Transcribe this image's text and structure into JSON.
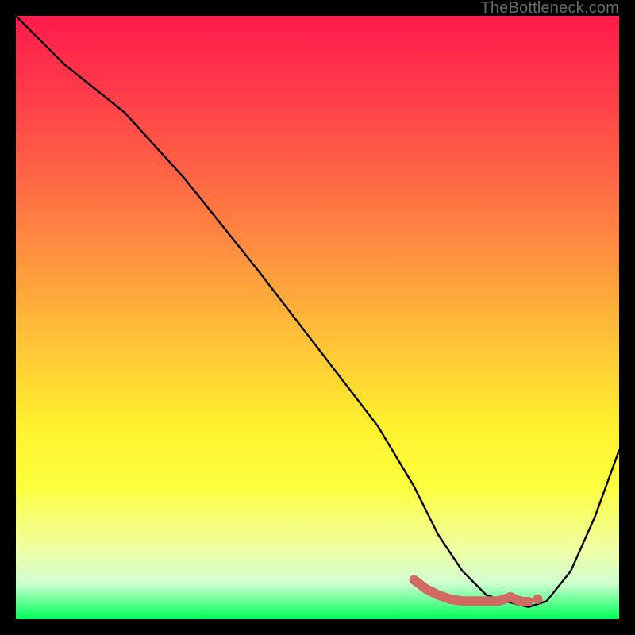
{
  "watermark": {
    "text": "TheBottleneck.com"
  },
  "chart_data": {
    "type": "line",
    "title": "",
    "xlabel": "",
    "ylabel": "",
    "xlim": [
      0,
      100
    ],
    "ylim": [
      0,
      100
    ],
    "grid": false,
    "series": [
      {
        "name": "curve",
        "x": [
          0,
          8,
          18,
          28,
          40,
          50,
          60,
          66,
          70,
          74,
          78,
          81,
          85,
          88,
          92,
          96,
          100
        ],
        "values": [
          100,
          92,
          84,
          73,
          58,
          45,
          32,
          22,
          14,
          8,
          4,
          3,
          2,
          3,
          8,
          17,
          28
        ]
      }
    ],
    "highlight_segment": {
      "color": "#d06a63",
      "x": [
        66,
        68,
        70,
        72,
        74,
        76,
        78,
        80,
        81,
        82,
        83,
        84,
        85
      ],
      "values": [
        6.5,
        5,
        4,
        3.3,
        3,
        3,
        3,
        3,
        3.3,
        3.7,
        3.2,
        2.9,
        2.9
      ]
    },
    "highlight_point": {
      "x": 86.5,
      "y": 3.3,
      "radius_px": 6,
      "color": "#d06a63"
    }
  },
  "colors": {
    "background": "#000000",
    "curve": "#000000",
    "highlight": "#d06a63",
    "gradient_top": "#ff1a4b",
    "gradient_bottom": "#00ff5a"
  }
}
